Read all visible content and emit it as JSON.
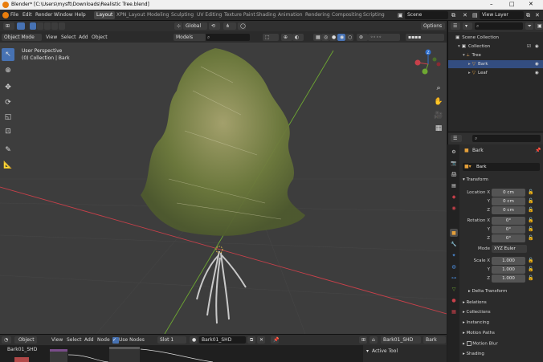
{
  "titlebar": {
    "title": "Blender* [C:\\Users\\mysft\\Downloads\\Realistic Tree.blend]"
  },
  "menu": [
    "File",
    "Edit",
    "Render",
    "Window",
    "Help"
  ],
  "workspaces": [
    "Layout",
    "XPN_Layout",
    "Modeling",
    "Sculpting",
    "UV Editing",
    "Texture Paint",
    "Shading",
    "Animation",
    "Rendering",
    "Compositing",
    "Scripting"
  ],
  "scene": "Scene",
  "view_layer": "View Layer",
  "viewport_header": {
    "mode": "Object Mode",
    "menus": [
      "View",
      "Select",
      "Add",
      "Object"
    ],
    "orientation": "Global",
    "options": "Options",
    "models_label": "Models"
  },
  "viewport": {
    "perspective": "User Perspective",
    "collection_info": "(0) Collection | Bark"
  },
  "gizmo": {
    "x_label": "X",
    "y_label": "Y",
    "z_label": "Z"
  },
  "outliner": {
    "scene_collection": "Scene Collection",
    "collection": "Collection",
    "tree": "Tree",
    "bark": "Bark",
    "leaf": "Leaf"
  },
  "properties": {
    "object_name": "Bark",
    "object_field": "Bark",
    "transform_header": "Transform",
    "location_label": "Location X",
    "location": [
      "0 cm",
      "0 cm",
      "0 cm"
    ],
    "rotation_label": "Rotation X",
    "rotation": [
      "0°",
      "0°",
      "0°"
    ],
    "mode_label": "Mode",
    "mode_value": "XYZ Euler",
    "scale_label": "Scale X",
    "scale": [
      "1.000",
      "1.000",
      "1.000"
    ],
    "axis_y": "Y",
    "axis_z": "Z",
    "sections": [
      "Delta Transform",
      "Relations",
      "Collections",
      "Instancing",
      "Motion Paths",
      "Motion Blur",
      "Shading"
    ]
  },
  "node_editor": {
    "editor_type": "Object",
    "menus": [
      "View",
      "Select",
      "Add",
      "Node"
    ],
    "use_nodes_label": "Use Nodes",
    "slot": "Slot 1",
    "material": "Bark01_SHD",
    "material_right": "Bark01_SHD",
    "object_right": "Bark",
    "material_title": "Bark01_SHD",
    "active_tool": "Active Tool"
  },
  "colors": {
    "accent": "#4772b3",
    "axis_x": "#c8404a",
    "axis_y": "#6ea832",
    "foliage": "#6d7a3c"
  }
}
